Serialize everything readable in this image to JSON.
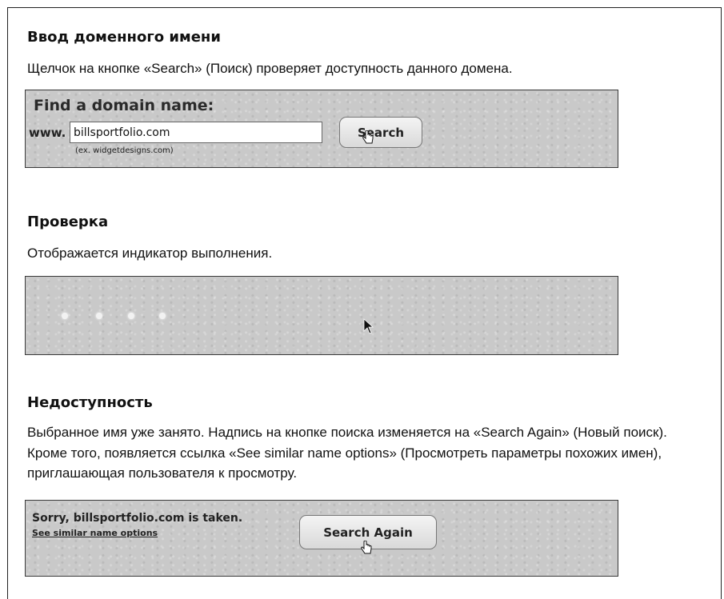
{
  "sections": {
    "enter": {
      "heading": "Ввод доменного имени",
      "text": "Щелчок на кнопке «Search» (Поиск) проверяет доступность данного домена."
    },
    "checking": {
      "heading": "Проверка",
      "text": "Отображается индикатор выполнения."
    },
    "unavailable": {
      "heading": "Недоступность",
      "text": "Выбранное имя уже занято. Надпись на кнопке поиска изменяется на «Search Again» (Новый поиск). Кроме того, появляется ссылка «See similar name options» (Просмотреть параметры похожих имен), приглашающая пользователя к просмотру."
    }
  },
  "find_panel": {
    "title": "Find a domain name:",
    "prefix": "www.",
    "input_value": "billsportfolio.com",
    "example": "(ex. widgetdesigns.com)",
    "search_label": "Search"
  },
  "progress_panel": {
    "dots_count": 4
  },
  "taken_panel": {
    "message": "Sorry, billsportfolio.com is taken.",
    "link": "See similar name options",
    "button_label": "Search Again"
  },
  "icons": {
    "hand": "hand-pointer-icon",
    "arrow": "mouse-arrow-icon"
  }
}
